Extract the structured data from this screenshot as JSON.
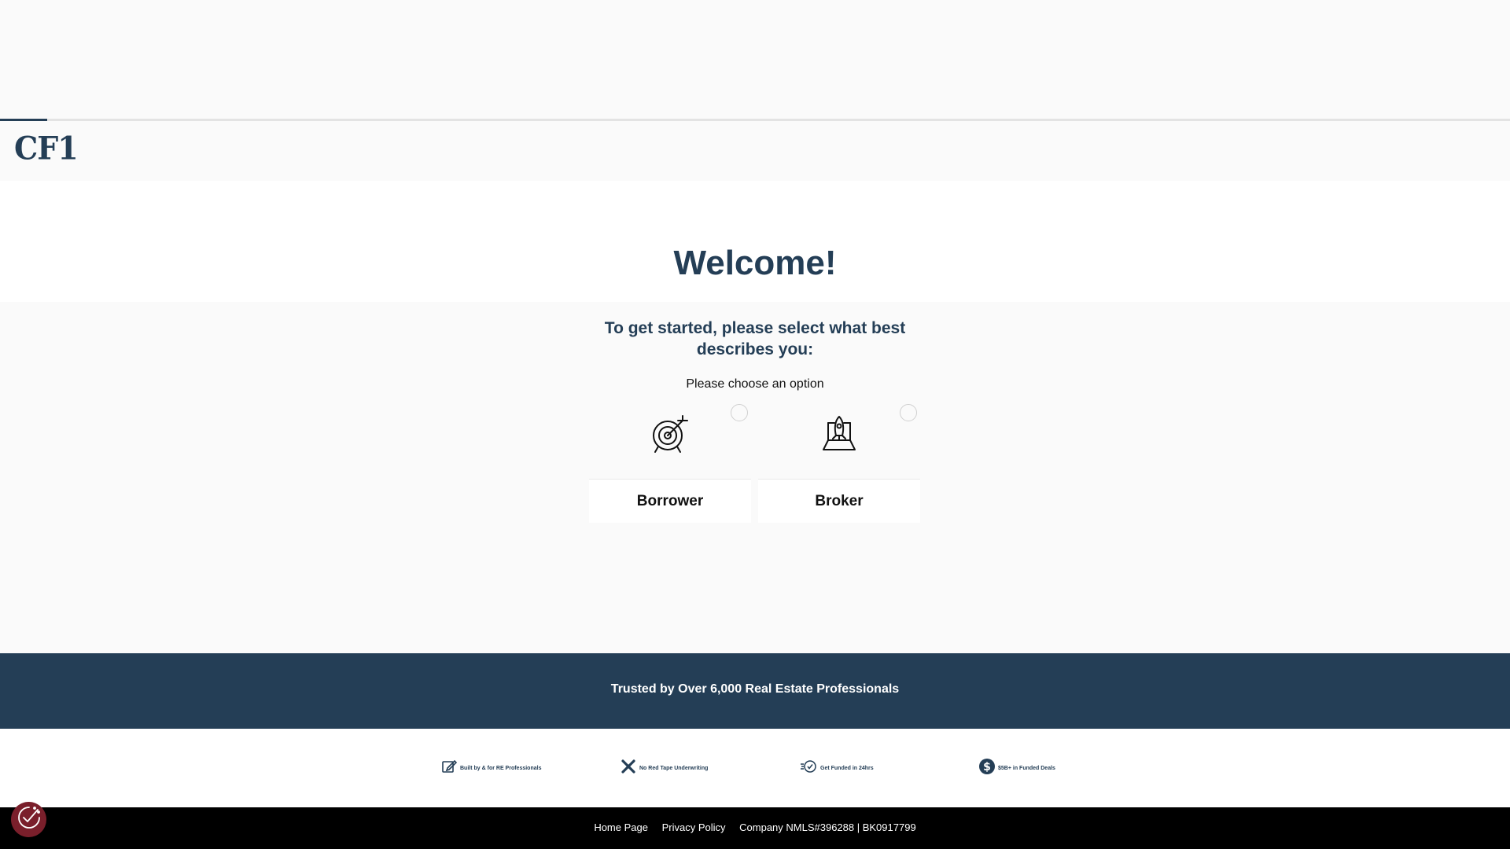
{
  "header": {
    "logo_text": "CF1"
  },
  "progress": {
    "percent": 3.1,
    "color": "#243e56"
  },
  "hero": {
    "title": "Welcome!"
  },
  "prompt": {
    "subtitle": "To get started, please select what best describes you:",
    "instruction": "Please choose an option"
  },
  "options": [
    {
      "label": "Borrower",
      "icon": "target-arrow-icon",
      "selected": false
    },
    {
      "label": "Broker",
      "icon": "rocket-laptop-icon",
      "selected": false
    }
  ],
  "trust_banner": {
    "text": "Trusted by Over 6,000 Real Estate Professionals"
  },
  "badges": [
    {
      "icon": "edit-icon",
      "text": "Built by & for RE Professionals"
    },
    {
      "icon": "x-icon",
      "text": "No Red Tape Underwriting"
    },
    {
      "icon": "fast-check-icon",
      "text": "Get Funded in 24hrs"
    },
    {
      "icon": "dollar-icon",
      "text": "$5B+ in Funded Deals"
    }
  ],
  "footer": {
    "home_label": "Home Page",
    "privacy_label": "Privacy Policy",
    "company_info": "Company NMLS#396288 | BK0917799"
  },
  "colors": {
    "brand": "#243e56",
    "cookie": "#7a1f2b"
  }
}
